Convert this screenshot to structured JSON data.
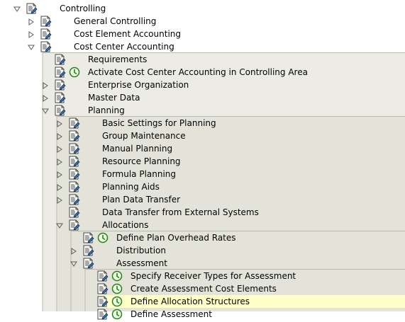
{
  "colors": {
    "background": "#ffffff",
    "level1_bg": "#f4f4ee",
    "level2_bg": "#ecece4",
    "level3_bg": "#e3e3da",
    "selected_bg": "#ffffc8",
    "connector": "#b9b9ae"
  },
  "tree": [
    {
      "level": 0,
      "expander": "collapse",
      "label": "Controlling",
      "exec": false
    },
    {
      "level": 1,
      "expander": "expand",
      "label": "General Controlling",
      "exec": false
    },
    {
      "level": 1,
      "expander": "expand",
      "label": "Cost Element Accounting",
      "exec": false
    },
    {
      "level": 1,
      "expander": "collapse",
      "label": "Cost Center Accounting",
      "exec": false
    },
    {
      "level": 2,
      "expander": "none",
      "label": "Requirements",
      "exec": false
    },
    {
      "level": 2,
      "expander": "none",
      "label": "Activate Cost Center Accounting in Controlling Area",
      "exec": true
    },
    {
      "level": 2,
      "expander": "expand",
      "label": "Enterprise Organization",
      "exec": false
    },
    {
      "level": 2,
      "expander": "expand",
      "label": "Master Data",
      "exec": false
    },
    {
      "level": 2,
      "expander": "collapse",
      "label": "Planning",
      "exec": false
    },
    {
      "level": 3,
      "expander": "expand",
      "label": "Basic Settings for Planning",
      "exec": false
    },
    {
      "level": 3,
      "expander": "expand",
      "label": "Group Maintenance",
      "exec": false
    },
    {
      "level": 3,
      "expander": "expand",
      "label": "Manual Planning",
      "exec": false
    },
    {
      "level": 3,
      "expander": "expand",
      "label": "Resource Planning",
      "exec": false
    },
    {
      "level": 3,
      "expander": "expand",
      "label": "Formula Planning",
      "exec": false
    },
    {
      "level": 3,
      "expander": "expand",
      "label": "Planning Aids",
      "exec": false
    },
    {
      "level": 3,
      "expander": "expand",
      "label": "Plan Data Transfer",
      "exec": false
    },
    {
      "level": 3,
      "expander": "none",
      "label": "Data Transfer from External Systems",
      "exec": false
    },
    {
      "level": 3,
      "expander": "collapse",
      "label": "Allocations",
      "exec": false
    },
    {
      "level": 4,
      "expander": "none",
      "label": "Define Plan Overhead Rates",
      "exec": true
    },
    {
      "level": 4,
      "expander": "expand",
      "label": "Distribution",
      "exec": false
    },
    {
      "level": 4,
      "expander": "collapse",
      "label": "Assessment",
      "exec": false
    },
    {
      "level": 5,
      "expander": "none",
      "label": "Specify Receiver Types for Assessment",
      "exec": true
    },
    {
      "level": 5,
      "expander": "none",
      "label": "Create Assessment Cost Elements",
      "exec": true
    },
    {
      "level": 5,
      "expander": "none",
      "label": "Define Allocation Structures",
      "exec": true,
      "selected": true
    },
    {
      "level": 5,
      "expander": "none",
      "label": "Define Assessment",
      "exec": true
    }
  ]
}
